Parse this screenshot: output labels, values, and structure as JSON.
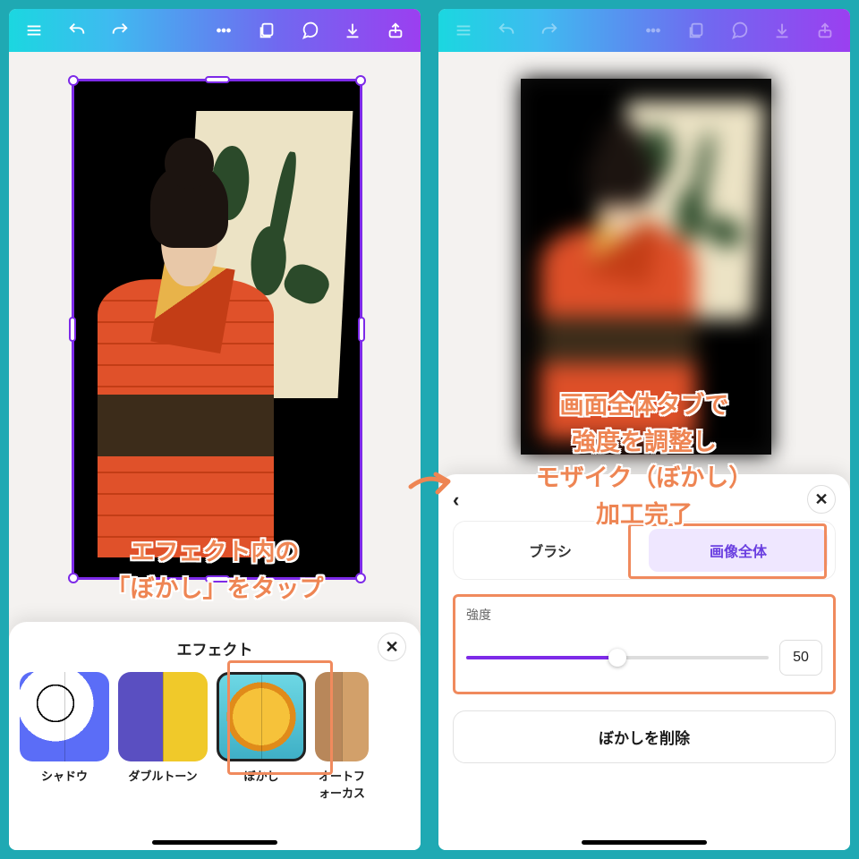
{
  "left": {
    "annotation": "エフェクト内の\n「ぼかし」をタップ",
    "sheet": {
      "title": "エフェクト",
      "effects": [
        {
          "label": "シャドウ"
        },
        {
          "label": "ダブルトーン"
        },
        {
          "label": "ぼかし"
        },
        {
          "label": "オートフォーカス"
        }
      ]
    }
  },
  "right": {
    "annotation": "画面全体タブで\n強度を調整し\nモザイク（ぼかし）\n加工完了",
    "sheet": {
      "tabs": {
        "brush": "ブラシ",
        "whole": "画像全体"
      },
      "slider": {
        "label": "強度",
        "value": "50"
      },
      "remove": "ぼかしを削除"
    }
  }
}
